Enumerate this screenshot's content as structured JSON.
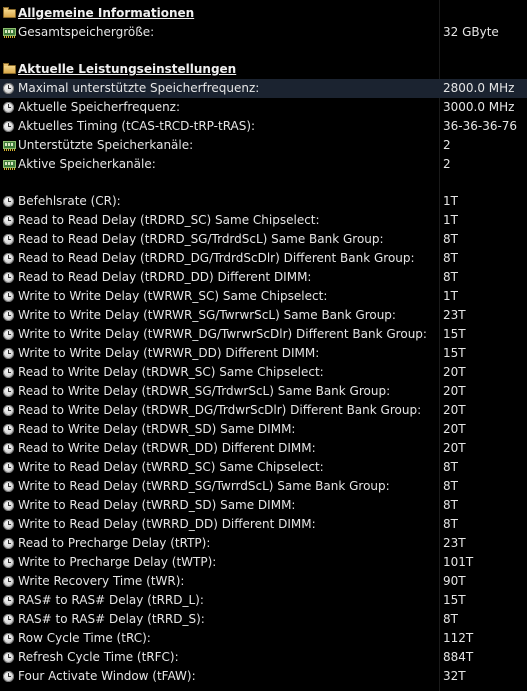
{
  "sections": [
    {
      "header": "Allgemeine Informationen",
      "icon": "folder-icon",
      "rows": [
        {
          "icon": "ram",
          "label": "Gesamtspeichergröße:",
          "value": "32 GByte"
        }
      ]
    },
    {
      "header": "Aktuelle Leistungseinstellungen",
      "icon": "folder-icon",
      "rows": [
        {
          "icon": "clock",
          "label": "Maximal unterstützte Speicherfrequenz:",
          "value": "2800.0 MHz",
          "selected": true
        },
        {
          "icon": "clock",
          "label": "Aktuelle Speicherfrequenz:",
          "value": "3000.0 MHz"
        },
        {
          "icon": "clock",
          "label": "Aktuelles Timing (tCAS-tRCD-tRP-tRAS):",
          "value": "36-36-36-76"
        },
        {
          "icon": "ram",
          "label": "Unterstützte Speicherkanäle:",
          "value": "2"
        },
        {
          "icon": "ram",
          "label": "Aktive Speicherkanäle:",
          "value": "2"
        }
      ]
    },
    {
      "header": "",
      "rows": [
        {
          "icon": "clock",
          "label": "Befehlsrate (CR):",
          "value": "1T"
        },
        {
          "icon": "clock",
          "label": "Read to Read Delay (tRDRD_SC) Same Chipselect:",
          "value": "1T"
        },
        {
          "icon": "clock",
          "label": "Read to Read Delay (tRDRD_SG/TrdrdScL) Same Bank Group:",
          "value": "8T"
        },
        {
          "icon": "clock",
          "label": "Read to Read Delay (tRDRD_DG/TrdrdScDlr) Different Bank Group:",
          "value": "8T"
        },
        {
          "icon": "clock",
          "label": "Read to Read Delay (tRDRD_DD) Different DIMM:",
          "value": "8T"
        },
        {
          "icon": "clock",
          "label": "Write to Write Delay (tWRWR_SC) Same Chipselect:",
          "value": "1T"
        },
        {
          "icon": "clock",
          "label": "Write to Write Delay (tWRWR_SG/TwrwrScL) Same Bank Group:",
          "value": "23T"
        },
        {
          "icon": "clock",
          "label": "Write to Write Delay (tWRWR_DG/TwrwrScDlr) Different Bank Group:",
          "value": "15T"
        },
        {
          "icon": "clock",
          "label": "Write to Write Delay (tWRWR_DD) Different DIMM:",
          "value": "15T"
        },
        {
          "icon": "clock",
          "label": "Read to Write Delay (tRDWR_SC) Same Chipselect:",
          "value": "20T"
        },
        {
          "icon": "clock",
          "label": "Read to Write Delay (tRDWR_SG/TrdwrScL) Same Bank Group:",
          "value": "20T"
        },
        {
          "icon": "clock",
          "label": "Read to Write Delay (tRDWR_DG/TrdwrScDlr) Different Bank Group:",
          "value": "20T"
        },
        {
          "icon": "clock",
          "label": "Read to Write Delay (tRDWR_SD) Same DIMM:",
          "value": "20T"
        },
        {
          "icon": "clock",
          "label": "Read to Write Delay (tRDWR_DD) Different DIMM:",
          "value": "20T"
        },
        {
          "icon": "clock",
          "label": "Write to Read Delay (tWRRD_SC) Same Chipselect:",
          "value": "8T"
        },
        {
          "icon": "clock",
          "label": "Write to Read Delay (tWRRD_SG/TwrrdScL) Same Bank Group:",
          "value": "8T"
        },
        {
          "icon": "clock",
          "label": "Write to Read Delay (tWRRD_SD) Same DIMM:",
          "value": "8T"
        },
        {
          "icon": "clock",
          "label": "Write to Read Delay (tWRRD_DD) Different DIMM:",
          "value": "8T"
        },
        {
          "icon": "clock",
          "label": "Read to Precharge Delay (tRTP):",
          "value": "23T"
        },
        {
          "icon": "clock",
          "label": "Write to Precharge Delay (tWTP):",
          "value": "101T"
        },
        {
          "icon": "clock",
          "label": "Write Recovery Time (tWR):",
          "value": "90T"
        },
        {
          "icon": "clock",
          "label": "RAS# to RAS# Delay (tRRD_L):",
          "value": "15T"
        },
        {
          "icon": "clock",
          "label": "RAS# to RAS# Delay (tRRD_S):",
          "value": "8T"
        },
        {
          "icon": "clock",
          "label": "Row Cycle Time (tRC):",
          "value": "112T"
        },
        {
          "icon": "clock",
          "label": "Refresh Cycle Time (tRFC):",
          "value": "884T"
        },
        {
          "icon": "clock",
          "label": "Four Activate Window (tFAW):",
          "value": "32T"
        }
      ]
    }
  ]
}
